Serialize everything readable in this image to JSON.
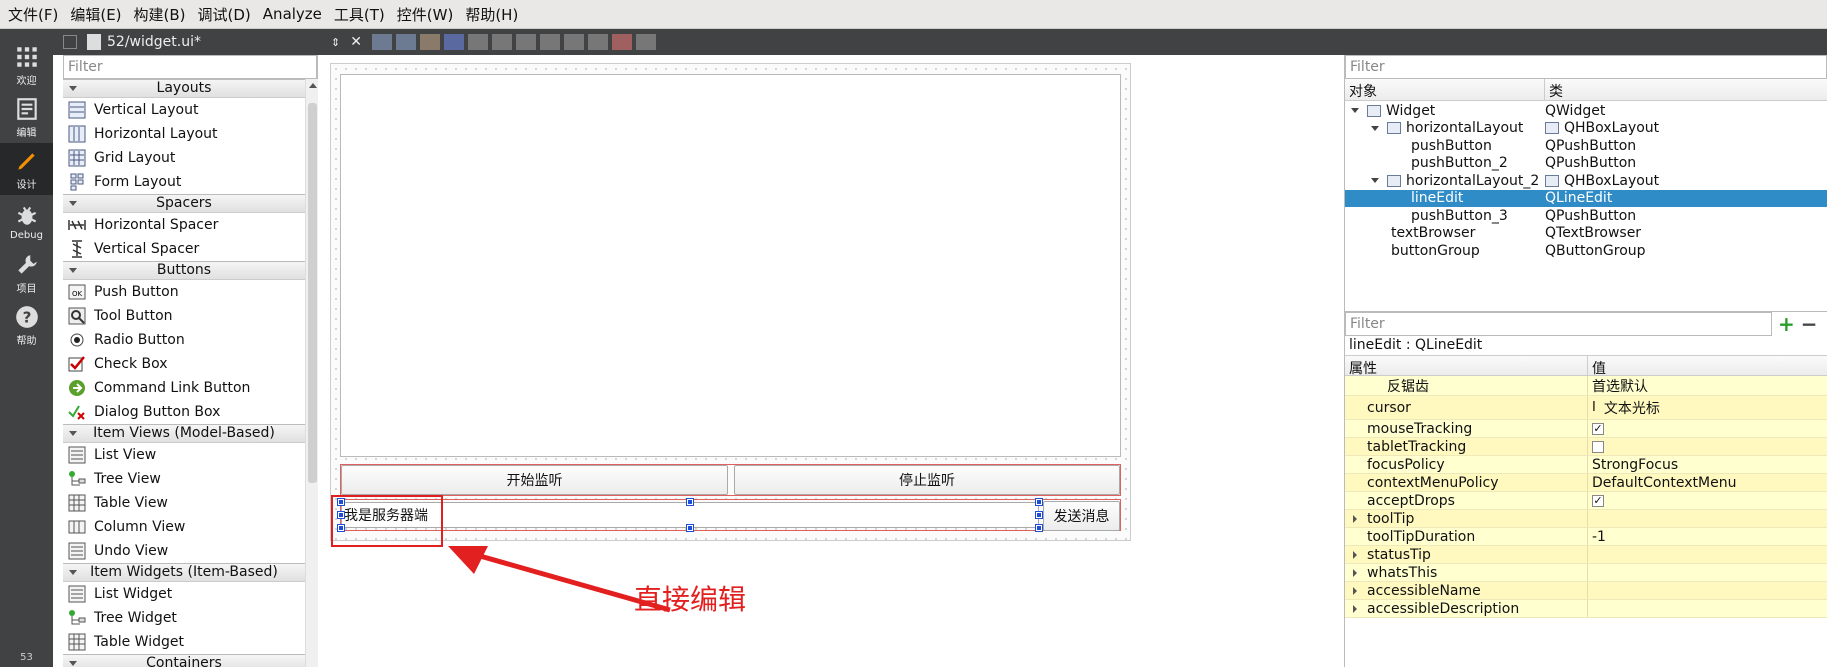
{
  "menubar": {
    "items": [
      "文件(F)",
      "编辑(E)",
      "构建(B)",
      "调试(D)",
      "Analyze",
      "工具(T)",
      "控件(W)",
      "帮助(H)"
    ]
  },
  "modebar": {
    "modes": [
      {
        "label": "欢迎",
        "icon": "grid-icon"
      },
      {
        "label": "编辑",
        "icon": "edit-doc-icon"
      },
      {
        "label": "设计",
        "icon": "pencil-icon"
      },
      {
        "label": "Debug",
        "icon": "bug-icon"
      },
      {
        "label": "项目",
        "icon": "wrench-icon"
      },
      {
        "label": "帮助",
        "icon": "help-icon"
      }
    ],
    "bottom_number": "53"
  },
  "editorbar": {
    "filename": "52/widget.ui*"
  },
  "widgetbox": {
    "filter_placeholder": "Filter",
    "categories": [
      {
        "name": "Layouts",
        "items": [
          "Vertical Layout",
          "Horizontal Layout",
          "Grid Layout",
          "Form Layout"
        ]
      },
      {
        "name": "Spacers",
        "items": [
          "Horizontal Spacer",
          "Vertical Spacer"
        ]
      },
      {
        "name": "Buttons",
        "items": [
          "Push Button",
          "Tool Button",
          "Radio Button",
          "Check Box",
          "Command Link Button",
          "Dialog Button Box"
        ]
      },
      {
        "name": "Item Views (Model-Based)",
        "items": [
          "List View",
          "Tree View",
          "Table View",
          "Column View",
          "Undo View"
        ]
      },
      {
        "name": "Item Widgets (Item-Based)",
        "items": [
          "List Widget",
          "Tree Widget",
          "Table Widget"
        ]
      },
      {
        "name": "Containers",
        "items": []
      }
    ]
  },
  "form": {
    "start_button": "开始监听",
    "stop_button": "停止监听",
    "line_edit_value": "我是服务器端",
    "send_button": "发送消息",
    "annotation": "直接编辑"
  },
  "object_inspector": {
    "filter_placeholder": "Filter",
    "col_object": "对象",
    "col_class": "类",
    "rows": [
      {
        "name": "Widget",
        "cls": "QWidget"
      },
      {
        "name": "horizontalLayout",
        "cls": "QHBoxLayout"
      },
      {
        "name": "pushButton",
        "cls": "QPushButton"
      },
      {
        "name": "pushButton_2",
        "cls": "QPushButton"
      },
      {
        "name": "horizontalLayout_2",
        "cls": "QHBoxLayout"
      },
      {
        "name": "lineEdit",
        "cls": "QLineEdit"
      },
      {
        "name": "pushButton_3",
        "cls": "QPushButton"
      },
      {
        "name": "textBrowser",
        "cls": "QTextBrowser"
      },
      {
        "name": "buttonGroup",
        "cls": "QButtonGroup"
      }
    ]
  },
  "property_editor": {
    "filter_placeholder": "Filter",
    "title": "lineEdit : QLineEdit",
    "col_property": "属性",
    "col_value": "值",
    "rows": [
      {
        "name": "反锯齿",
        "value": "首选默认"
      },
      {
        "name": "cursor",
        "value": "文本光标"
      },
      {
        "name": "mouseTracking",
        "value": "✓"
      },
      {
        "name": "tabletTracking",
        "value": ""
      },
      {
        "name": "focusPolicy",
        "value": "StrongFocus"
      },
      {
        "name": "contextMenuPolicy",
        "value": "DefaultContextMenu"
      },
      {
        "name": "acceptDrops",
        "value": "✓"
      },
      {
        "name": "toolTip",
        "value": ""
      },
      {
        "name": "toolTipDuration",
        "value": "-1"
      },
      {
        "name": "statusTip",
        "value": ""
      },
      {
        "name": "whatsThis",
        "value": ""
      },
      {
        "name": "accessibleName",
        "value": ""
      },
      {
        "name": "accessibleDescription",
        "value": ""
      }
    ]
  }
}
